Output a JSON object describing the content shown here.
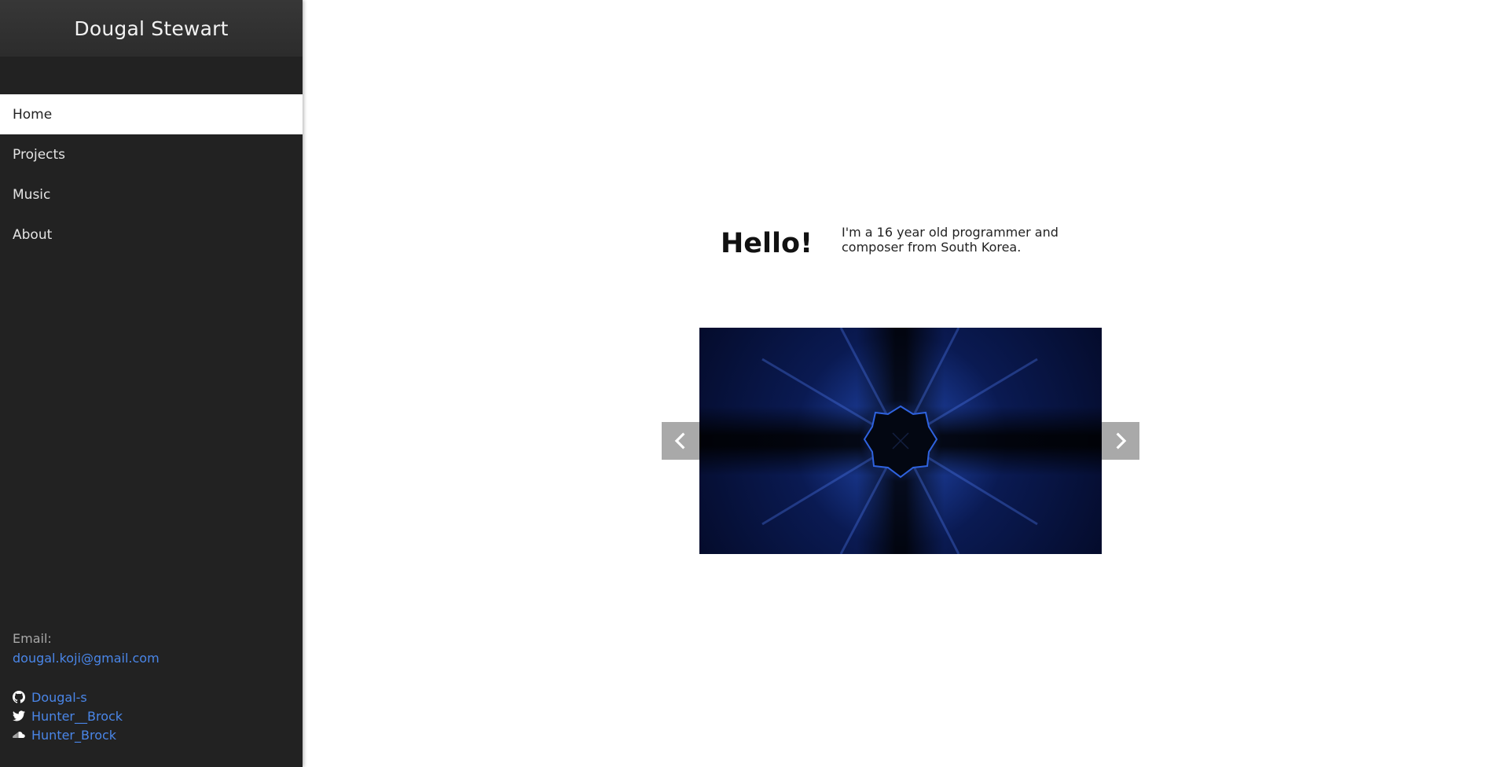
{
  "site": {
    "title": "Dougal Stewart"
  },
  "nav": {
    "items": [
      {
        "label": "Home",
        "active": true
      },
      {
        "label": "Projects",
        "active": false
      },
      {
        "label": "Music",
        "active": false
      },
      {
        "label": "About",
        "active": false
      }
    ]
  },
  "contact": {
    "email_label": "Email:",
    "email": "dougal.koji@gmail.com",
    "social": [
      {
        "icon": "github-icon",
        "label": "Dougal-s"
      },
      {
        "icon": "twitter-icon",
        "label": "Hunter__Brock"
      },
      {
        "icon": "soundcloud-icon",
        "label": "Hunter_Brock"
      }
    ]
  },
  "main": {
    "greeting": "Hello!",
    "intro": "I'm a 16 year old programmer and composer from South Korea.",
    "carousel": {
      "prev_icon": "chevron-left-icon",
      "next_icon": "chevron-right-icon"
    }
  },
  "colors": {
    "sidebar_bg": "#222222",
    "link": "#4a86e8",
    "arrow_bg": "#a9a9a9"
  }
}
